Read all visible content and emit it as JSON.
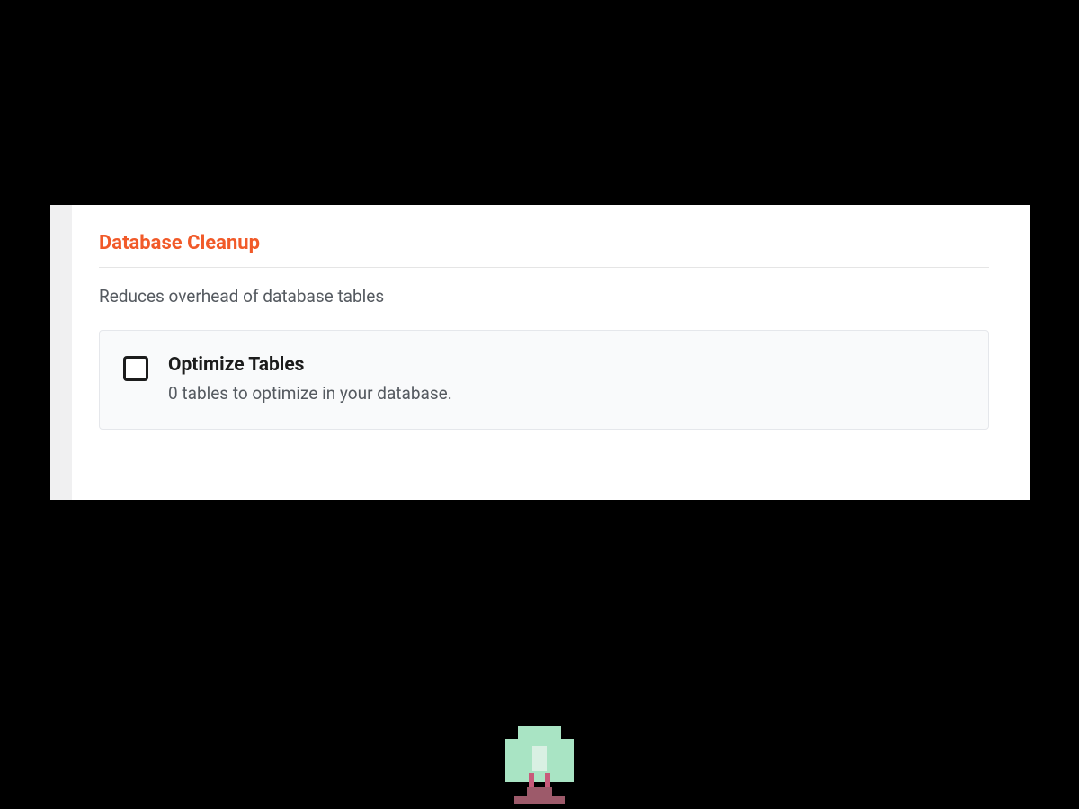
{
  "section": {
    "title": "Database Cleanup",
    "description": "Reduces overhead of database tables"
  },
  "option": {
    "title": "Optimize Tables",
    "subtitle": "0 tables to optimize in your database.",
    "checked": false
  },
  "colors": {
    "accent": "#f15a29"
  }
}
